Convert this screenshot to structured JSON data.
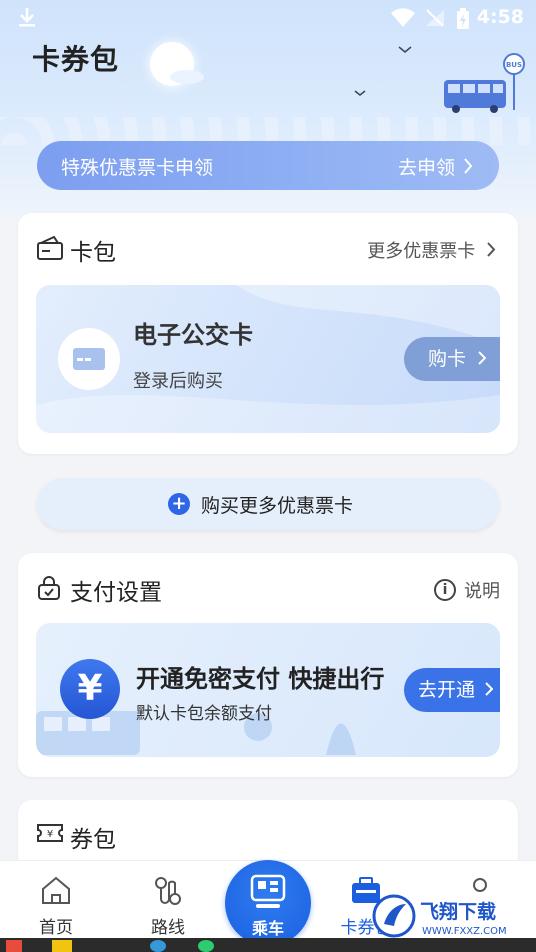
{
  "status": {
    "time": "4:58"
  },
  "header": {
    "title": "卡券包",
    "bus_sign": "BUS"
  },
  "banner": {
    "label": "特殊优惠票卡申领",
    "action": "去申领"
  },
  "card_pack": {
    "title": "卡包",
    "more": "更多优惠票卡",
    "card_name": "电子公交卡",
    "card_sub": "登录后购买",
    "buy_button": "购卡"
  },
  "buy_more": {
    "label": "购买更多优惠票卡"
  },
  "payment": {
    "title": "支付设置",
    "help": "说明",
    "headline": "开通免密支付 快捷出行",
    "sub": "默认卡包余额支付",
    "action": "去开通",
    "yuan": "¥"
  },
  "coupon": {
    "title": "券包"
  },
  "nav": {
    "home": "首页",
    "routes": "路线",
    "ride": "乘车",
    "wallet": "卡券包"
  },
  "watermark": {
    "text": "飞翔下载",
    "url": "WWW.FXXZ.COM"
  },
  "colors": {
    "accent": "#1a5fe0",
    "banner": "#8fb0f3",
    "pay_icon": "#2f66e6"
  }
}
